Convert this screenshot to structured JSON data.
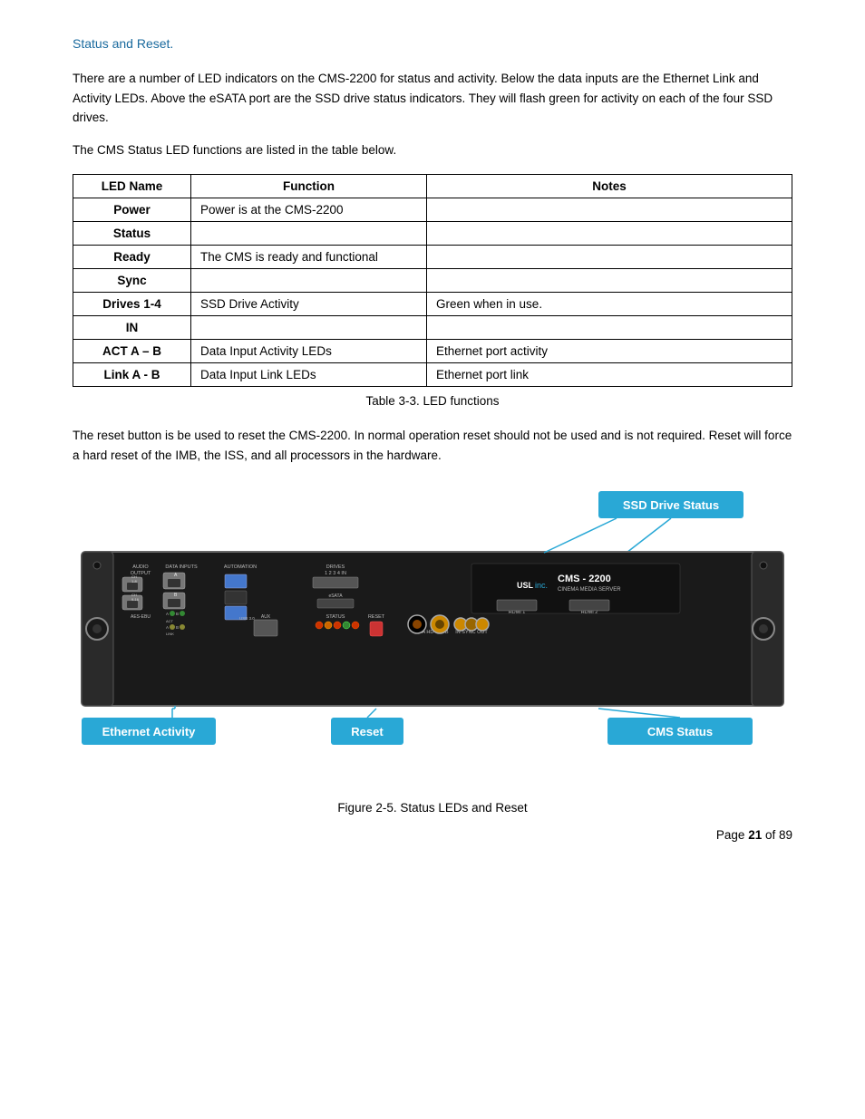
{
  "page": {
    "section_title": "Status and Reset.",
    "body_text_1": "There are a number of LED indicators on the CMS-2200 for status and activity.  Below the data inputs are the Ethernet Link and Activity LEDs.  Above the eSATA port are the SSD drive status indicators.  They will flash green for activity on each of the four SSD drives.",
    "body_text_2": "The CMS Status LED functions are listed in the table below.",
    "table_caption": "Table 3-3. LED functions",
    "reset_text": "The reset button is be used to reset the CMS-2200.  In normal operation reset should not be used and is not required.  Reset will force a hard reset of the IMB, the ISS, and all processors in the hardware.",
    "figure_caption": "Figure 2-5.  Status LEDs and Reset",
    "page_number": "Page 21 of 89",
    "table": {
      "headers": [
        "LED Name",
        "Function",
        "Notes"
      ],
      "rows": [
        {
          "name": "Power",
          "function": "Power is at the CMS-2200",
          "notes": ""
        },
        {
          "name": "Status",
          "function": "",
          "notes": ""
        },
        {
          "name": "Ready",
          "function": "The CMS is ready and functional",
          "notes": ""
        },
        {
          "name": "Sync",
          "function": "",
          "notes": ""
        },
        {
          "name": "Drives 1-4",
          "function": "SSD Drive Activity",
          "notes": "Green when in use."
        },
        {
          "name": "IN",
          "function": "",
          "notes": ""
        },
        {
          "name": "ACT A – B",
          "function": "Data Input Activity LEDs",
          "notes": "Ethernet port activity"
        },
        {
          "name": "Link A - B",
          "function": "Data Input Link LEDs",
          "notes": "Ethernet port link"
        }
      ]
    },
    "callout_labels": {
      "ssd_drive_status": "SSD Drive Status",
      "ethernet_activity": "Ethernet Activity",
      "reset": "Reset",
      "cms_status": "CMS Status"
    },
    "colors": {
      "title_blue": "#1a6a9e",
      "callout_blue": "#29a8d6"
    }
  }
}
